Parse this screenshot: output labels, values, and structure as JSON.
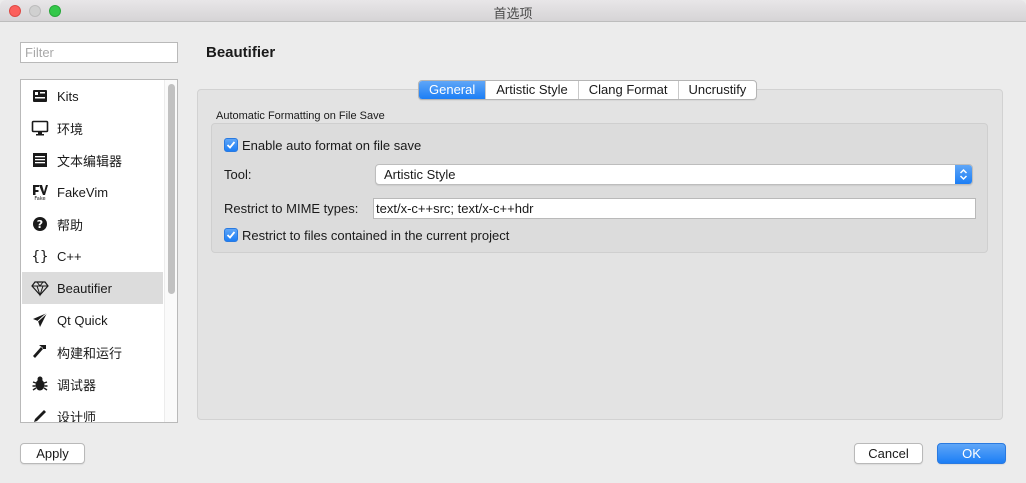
{
  "window": {
    "title": "首选项"
  },
  "filter": {
    "placeholder": "Filter",
    "value": ""
  },
  "sidebar": {
    "items": [
      {
        "label": "Kits",
        "icon": "kits-icon"
      },
      {
        "label": "环境",
        "icon": "monitor-icon"
      },
      {
        "label": "文本编辑器",
        "icon": "text-editor-icon"
      },
      {
        "label": "FakeVim",
        "icon": "fakevim-icon"
      },
      {
        "label": "帮助",
        "icon": "help-icon"
      },
      {
        "label": "C++",
        "icon": "braces-icon"
      },
      {
        "label": "Beautifier",
        "icon": "diamond-icon",
        "selected": true
      },
      {
        "label": "Qt Quick",
        "icon": "paper-plane-icon"
      },
      {
        "label": "构建和运行",
        "icon": "hammer-icon"
      },
      {
        "label": "调试器",
        "icon": "bug-icon"
      },
      {
        "label": "设计师",
        "icon": "pencil-icon"
      }
    ]
  },
  "page": {
    "title": "Beautifier"
  },
  "tabs": [
    {
      "label": "General",
      "active": true
    },
    {
      "label": "Artistic Style",
      "active": false
    },
    {
      "label": "Clang Format",
      "active": false
    },
    {
      "label": "Uncrustify",
      "active": false
    }
  ],
  "general": {
    "group_title": "Automatic Formatting on File Save",
    "enable_auto_format": {
      "label": "Enable auto format on file save",
      "checked": true
    },
    "tool": {
      "label": "Tool:",
      "value": "Artistic Style"
    },
    "mime": {
      "label": "Restrict to MIME types:",
      "value": "text/x-c++src; text/x-c++hdr"
    },
    "restrict_project": {
      "label": "Restrict to files contained in the current project",
      "checked": true
    }
  },
  "buttons": {
    "apply": "Apply",
    "cancel": "Cancel",
    "ok": "OK"
  },
  "colors": {
    "accent": "#1c7ef5",
    "selected_row": "#dcdcdc"
  }
}
